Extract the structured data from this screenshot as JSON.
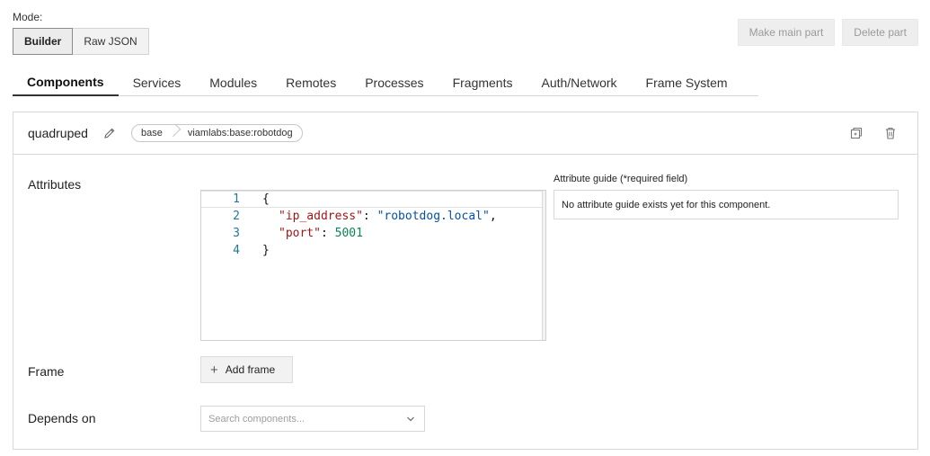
{
  "mode": {
    "label": "Mode:",
    "options": [
      "Builder",
      "Raw JSON"
    ],
    "selected": "Builder"
  },
  "actions": {
    "make_main_part": "Make main part",
    "delete_part": "Delete part"
  },
  "tabs": [
    {
      "label": "Components",
      "active": true
    },
    {
      "label": "Services",
      "active": false
    },
    {
      "label": "Modules",
      "active": false
    },
    {
      "label": "Remotes",
      "active": false
    },
    {
      "label": "Processes",
      "active": false
    },
    {
      "label": "Fragments",
      "active": false
    },
    {
      "label": "Auth/Network",
      "active": false
    },
    {
      "label": "Frame System",
      "active": false
    }
  ],
  "component": {
    "name": "quadruped",
    "type": "base",
    "model": "viamlabs:base:robotdog"
  },
  "icons": {
    "edit": "pencil-icon",
    "duplicate": "copy-icon",
    "delete": "trash-icon",
    "add": "plus-icon",
    "dropdown": "chevron-down-icon"
  },
  "attributes": {
    "label": "Attributes",
    "code_lines": [
      {
        "num": "1",
        "text": "{"
      },
      {
        "num": "2",
        "key": "\"ip_address\"",
        "value": "\"robotdog.local\"",
        "trail": ","
      },
      {
        "num": "3",
        "key": "\"port\"",
        "value": "5001",
        "trail": ""
      },
      {
        "num": "4",
        "text": "}"
      }
    ]
  },
  "guide": {
    "title": "Attribute guide (*required field)",
    "message": "No attribute guide exists yet for this component."
  },
  "frame": {
    "label": "Frame",
    "button": "Add frame"
  },
  "depends_on": {
    "label": "Depends on",
    "placeholder": "Search components..."
  },
  "colors": {
    "line_number": "#237893",
    "json_key": "#a31515",
    "json_string": "#0451a5",
    "json_number": "#098658"
  }
}
